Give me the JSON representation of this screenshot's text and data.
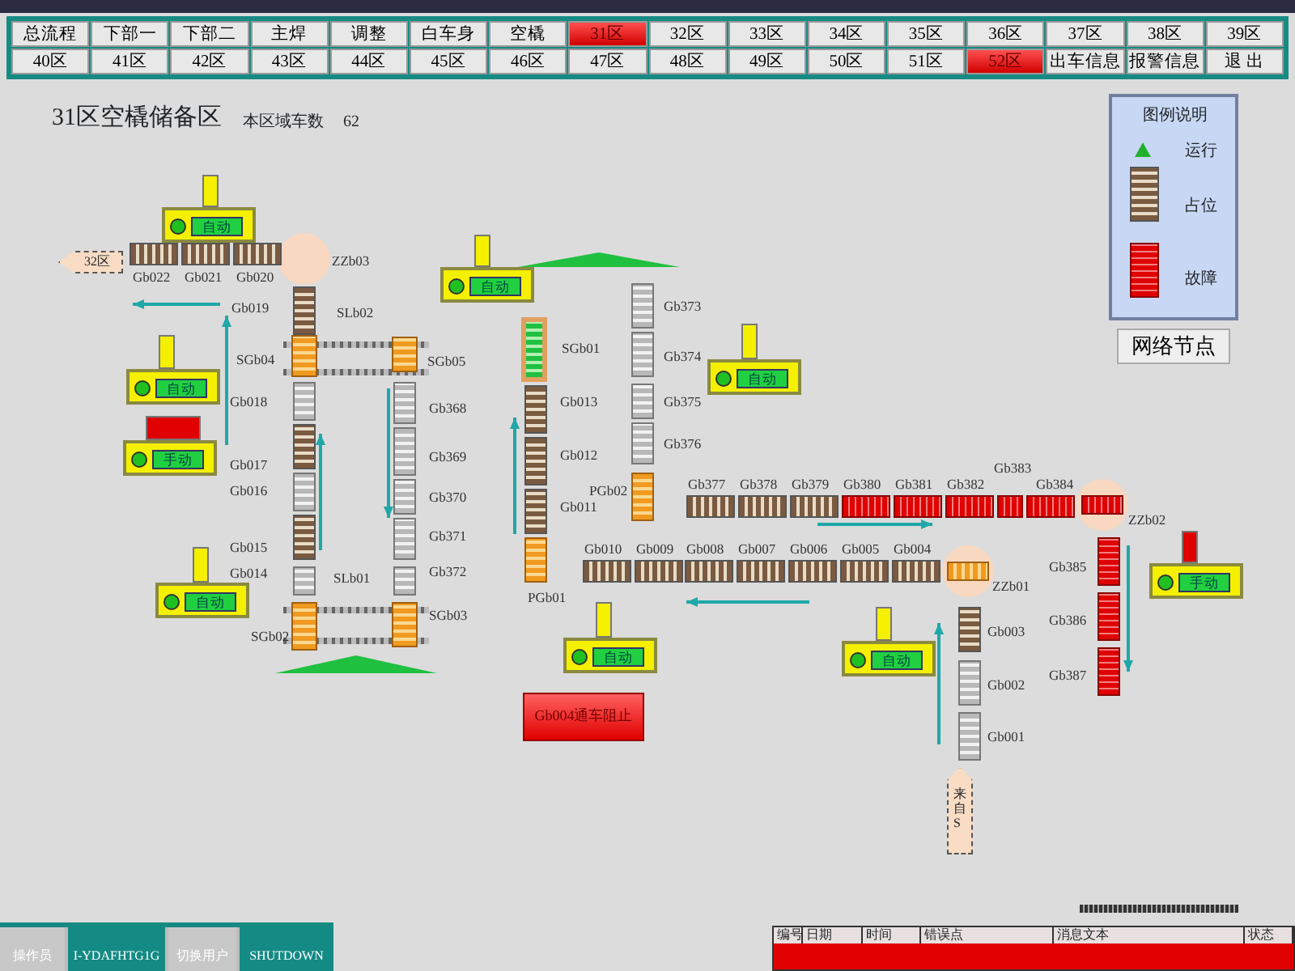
{
  "nav_rows": [
    [
      {
        "label": "总流程",
        "selected": false
      },
      {
        "label": "下部一",
        "selected": false
      },
      {
        "label": "下部二",
        "selected": false
      },
      {
        "label": "主焊",
        "selected": false
      },
      {
        "label": "调整",
        "selected": false
      },
      {
        "label": "白车身",
        "selected": false
      },
      {
        "label": "空橇",
        "selected": false
      },
      {
        "label": "31区",
        "selected": true
      },
      {
        "label": "32区",
        "selected": false
      },
      {
        "label": "33区",
        "selected": false
      },
      {
        "label": "34区",
        "selected": false
      },
      {
        "label": "35区",
        "selected": false
      },
      {
        "label": "36区",
        "selected": false
      },
      {
        "label": "37区",
        "selected": false
      },
      {
        "label": "38区",
        "selected": false
      },
      {
        "label": "39区",
        "selected": false
      }
    ],
    [
      {
        "label": "40区",
        "selected": false
      },
      {
        "label": "41区",
        "selected": false
      },
      {
        "label": "42区",
        "selected": false
      },
      {
        "label": "43区",
        "selected": false
      },
      {
        "label": "44区",
        "selected": false
      },
      {
        "label": "45区",
        "selected": false
      },
      {
        "label": "46区",
        "selected": false
      },
      {
        "label": "47区",
        "selected": false
      },
      {
        "label": "48区",
        "selected": false
      },
      {
        "label": "49区",
        "selected": false
      },
      {
        "label": "50区",
        "selected": false
      },
      {
        "label": "51区",
        "selected": false
      },
      {
        "label": "52区",
        "selected": true
      },
      {
        "label": "出车信息",
        "selected": false
      },
      {
        "label": "报警信息",
        "selected": false
      },
      {
        "label": "退 出",
        "selected": false
      }
    ]
  ],
  "area": {
    "title": "31区空橇储备区",
    "count_label": "本区域车数",
    "count": "62"
  },
  "legend": {
    "title": "图例说明",
    "items": [
      {
        "kind": "running",
        "label": "运行"
      },
      {
        "kind": "occupied",
        "label": "占位"
      },
      {
        "kind": "fault",
        "label": "故障"
      }
    ]
  },
  "network_button": "网络节点",
  "segments": [
    {
      "label": "Gb022",
      "kind": "occupied"
    },
    {
      "label": "Gb021",
      "kind": "occupied"
    },
    {
      "label": "Gb020",
      "kind": "occupied"
    },
    {
      "label": "Gb019",
      "kind": "occupied"
    },
    {
      "label": "SGb04",
      "kind": "transfer"
    },
    {
      "label": "SGb05",
      "kind": "transfer"
    },
    {
      "label": "Gb018",
      "kind": "empty"
    },
    {
      "label": "Gb017",
      "kind": "occupied"
    },
    {
      "label": "Gb016",
      "kind": "empty"
    },
    {
      "label": "Gb015",
      "kind": "occupied"
    },
    {
      "label": "Gb014",
      "kind": "empty"
    },
    {
      "label": "SGb02",
      "kind": "transfer"
    },
    {
      "label": "Gb368",
      "kind": "empty"
    },
    {
      "label": "Gb369",
      "kind": "empty"
    },
    {
      "label": "Gb370",
      "kind": "empty"
    },
    {
      "label": "Gb371",
      "kind": "empty"
    },
    {
      "label": "Gb372",
      "kind": "empty"
    },
    {
      "label": "SGb03",
      "kind": "transfer"
    },
    {
      "label": "SGb01",
      "kind": "running"
    },
    {
      "label": "Gb013",
      "kind": "occupied"
    },
    {
      "label": "Gb012",
      "kind": "occupied"
    },
    {
      "label": "Gb011",
      "kind": "occupied"
    },
    {
      "label": "PGb01",
      "kind": "transfer"
    },
    {
      "label": "Gb373",
      "kind": "empty"
    },
    {
      "label": "Gb374",
      "kind": "empty"
    },
    {
      "label": "Gb375",
      "kind": "empty"
    },
    {
      "label": "Gb376",
      "kind": "empty"
    },
    {
      "label": "PGb02",
      "kind": "transfer"
    },
    {
      "label": "Gb377",
      "kind": "occupied"
    },
    {
      "label": "Gb378",
      "kind": "occupied"
    },
    {
      "label": "Gb379",
      "kind": "occupied"
    },
    {
      "label": "Gb380",
      "kind": "fault"
    },
    {
      "label": "Gb381",
      "kind": "fault"
    },
    {
      "label": "Gb382",
      "kind": "fault"
    },
    {
      "label": "Gb383",
      "kind": "fault"
    },
    {
      "label": "Gb384",
      "kind": "fault"
    },
    {
      "label": "Gb010",
      "kind": "occupied"
    },
    {
      "label": "Gb009",
      "kind": "occupied"
    },
    {
      "label": "Gb008",
      "kind": "occupied"
    },
    {
      "label": "Gb007",
      "kind": "occupied"
    },
    {
      "label": "Gb006",
      "kind": "occupied"
    },
    {
      "label": "Gb005",
      "kind": "occupied"
    },
    {
      "label": "Gb004",
      "kind": "occupied"
    },
    {
      "label": "Gb003",
      "kind": "occupied"
    },
    {
      "label": "Gb002",
      "kind": "empty"
    },
    {
      "label": "Gb001",
      "kind": "empty"
    },
    {
      "label": "Gb385",
      "kind": "fault"
    },
    {
      "label": "Gb386",
      "kind": "fault"
    },
    {
      "label": "Gb387",
      "kind": "fault"
    }
  ],
  "turntables": [
    {
      "label": "ZZb03",
      "kind": "empty"
    },
    {
      "label": "ZZb02",
      "kind": "fault"
    },
    {
      "label": "ZZb01",
      "kind": "transfer"
    }
  ],
  "lift_labels": [
    "SLb02",
    "SLb01"
  ],
  "controllers": [
    {
      "mode": "自动",
      "fault": false
    },
    {
      "mode": "自动",
      "fault": false
    },
    {
      "mode": "自动",
      "fault": false
    },
    {
      "mode": "手动",
      "fault": true
    },
    {
      "mode": "自动",
      "fault": false
    },
    {
      "mode": "自动",
      "fault": false
    },
    {
      "mode": "自动",
      "fault": false
    },
    {
      "mode": "自动",
      "fault": false
    },
    {
      "mode": "手动",
      "fault": true
    }
  ],
  "tags": [
    {
      "kind": "left",
      "label": "32区"
    },
    {
      "kind": "up",
      "label": "来自S"
    }
  ],
  "block_button": "Gb004通车阻止",
  "bottom_buttons": [
    "操作员",
    "I-YDAFHTG1G",
    "切换用户",
    "SHUTDOWN"
  ],
  "alarm_table": {
    "columns": [
      "编号",
      "日期",
      "时间",
      "错误点",
      "消息文本",
      "状态"
    ]
  }
}
